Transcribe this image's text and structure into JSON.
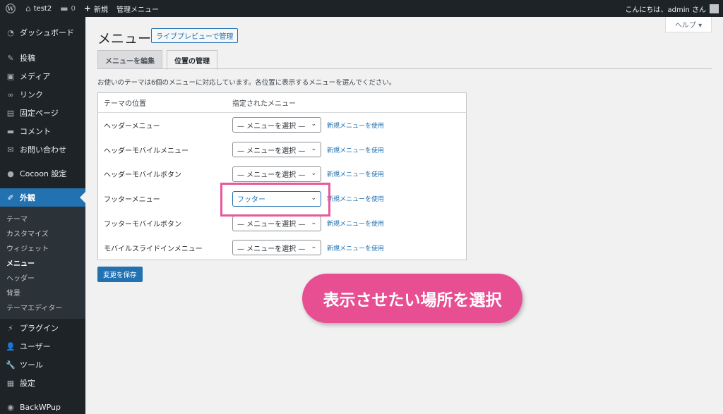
{
  "adminbar": {
    "site_name": "test2",
    "comments_count": "0",
    "new_label": "新規",
    "manage_menu": "管理メニュー",
    "greeting": "こんにちは、admin さん"
  },
  "sidebar": {
    "items": [
      {
        "label": "ダッシュボード",
        "icon": "dashboard-icon"
      },
      {
        "label": "投稿",
        "icon": "pin-icon"
      },
      {
        "label": "メディア",
        "icon": "media-icon"
      },
      {
        "label": "リンク",
        "icon": "link-icon"
      },
      {
        "label": "固定ページ",
        "icon": "page-icon"
      },
      {
        "label": "コメント",
        "icon": "comment-icon"
      },
      {
        "label": "お問い合わせ",
        "icon": "mail-icon"
      },
      {
        "label": "Cocoon 設定",
        "icon": "cocoon-icon"
      },
      {
        "label": "外観",
        "icon": "brush-icon"
      },
      {
        "label": "プラグイン",
        "icon": "plugin-icon"
      },
      {
        "label": "ユーザー",
        "icon": "user-icon"
      },
      {
        "label": "ツール",
        "icon": "wrench-icon"
      },
      {
        "label": "設定",
        "icon": "settings-icon"
      },
      {
        "label": "BackWPup",
        "icon": "backwpup-icon"
      }
    ],
    "submenu": [
      "テーマ",
      "カスタマイズ",
      "ウィジェット",
      "メニュー",
      "ヘッダー",
      "背景",
      "テーマエディター"
    ]
  },
  "help": {
    "label": "ヘルプ ▾"
  },
  "page": {
    "title": "メニュー",
    "live_preview": "ライブプレビューで管理",
    "tabs": [
      "メニューを編集",
      "位置の管理"
    ],
    "description": "お使いのテーマは6個のメニューに対応しています。各位置に表示するメニューを選んでください。"
  },
  "locations": {
    "col_theme": "テーマの位置",
    "col_assigned": "指定されたメニュー",
    "use_new": "新規メニューを使用",
    "rows": [
      {
        "name": "ヘッダーメニュー",
        "selected": "— メニューを選択 —"
      },
      {
        "name": "ヘッダーモバイルメニュー",
        "selected": "— メニューを選択 —"
      },
      {
        "name": "ヘッダーモバイルボタン",
        "selected": "— メニューを選択 —"
      },
      {
        "name": "フッターメニュー",
        "selected": "フッター"
      },
      {
        "name": "フッターモバイルボタン",
        "selected": "— メニューを選択 —"
      },
      {
        "name": "モバイルスライドインメニュー",
        "selected": "— メニューを選択 —"
      }
    ]
  },
  "save_label": "変更を保存",
  "callout_text": "表示させたい場所を選択",
  "colors": {
    "accent": "#2271b1",
    "highlight": "#e84f93",
    "sidebar": "#1d2327"
  }
}
